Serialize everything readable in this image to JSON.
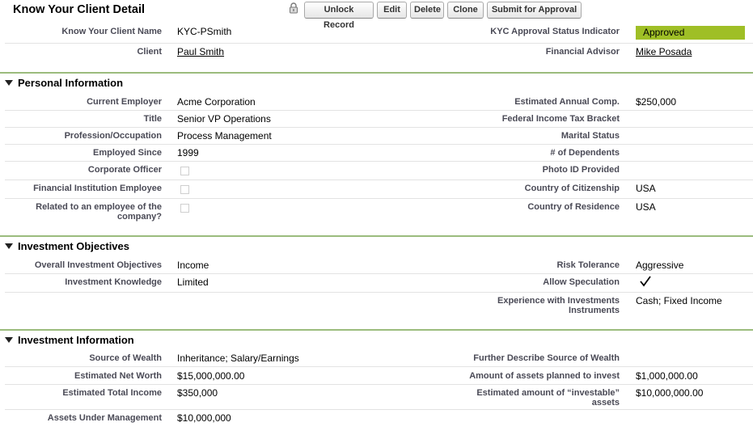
{
  "header": {
    "title": "Know Your Client Detail",
    "buttons": {
      "unlock": "Unlock Record",
      "edit": "Edit",
      "delete": "Delete",
      "clone": "Clone",
      "submit": "Submit for Approval"
    }
  },
  "top": {
    "kyc_name_label": "Know Your Client Name",
    "kyc_name_value": "KYC-PSmith",
    "approval_label": "KYC Approval Status Indicator",
    "approval_value": "Approved",
    "approval_color": "#9fbf26",
    "client_label": "Client",
    "client_value": "Paul Smith",
    "advisor_label": "Financial Advisor",
    "advisor_value": "Mike Posada"
  },
  "personal": {
    "title": "Personal Information",
    "employer_label": "Current Employer",
    "employer_value": "Acme Corporation",
    "comp_label": "Estimated Annual Comp.",
    "comp_value": "$250,000",
    "title_label": "Title",
    "title_value": "Senior VP Operations",
    "tax_label": "Federal Income Tax Bracket",
    "profession_label": "Profession/Occupation",
    "profession_value": "Process Management",
    "marital_label": "Marital Status",
    "employed_label": "Employed Since",
    "employed_value": "1999",
    "dependents_label": "# of Dependents",
    "officer_label": "Corporate Officer",
    "officer_checked": false,
    "photo_label": "Photo ID Provided",
    "fin_employee_label": "Financial Institution Employee",
    "fin_employee_checked": false,
    "citizenship_label": "Country of Citizenship",
    "citizenship_value": "USA",
    "related_label_1": "Related to an employee of the",
    "related_label_2": "company?",
    "related_checked": false,
    "residence_label": "Country of Residence",
    "residence_value": "USA"
  },
  "objectives": {
    "title": "Investment Objectives",
    "overall_label": "Overall Investment Objectives",
    "overall_value": "Income",
    "risk_label": "Risk Tolerance",
    "risk_value": "Aggressive",
    "knowledge_label": "Investment Knowledge",
    "knowledge_value": "Limited",
    "speculation_label": "Allow Speculation",
    "speculation_checked": true,
    "experience_label_1": "Experience with Investments",
    "experience_label_2": "Instruments",
    "experience_value": "Cash; Fixed Income"
  },
  "information": {
    "title": "Investment Information",
    "source_label": "Source of Wealth",
    "source_value": "Inheritance; Salary/Earnings",
    "further_label": "Further Describe Source of Wealth",
    "networth_label": "Estimated Net Worth",
    "networth_value": "$15,000,000.00",
    "planned_label": "Amount of assets planned to invest",
    "planned_value": "$1,000,000.00",
    "total_income_label": "Estimated Total Income",
    "total_income_value": "$350,000",
    "investable_label_1": "Estimated amount of “investable”",
    "investable_label_2": "assets",
    "investable_value": "$10,000,000.00",
    "aum_label": "Assets Under Management",
    "aum_value": "$10,000,000"
  }
}
